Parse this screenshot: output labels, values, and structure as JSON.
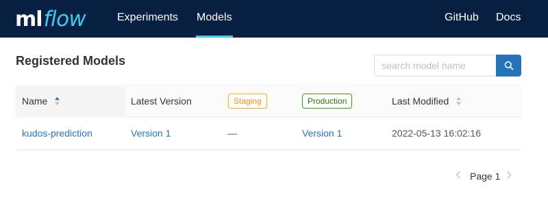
{
  "nav": {
    "logo_ml": "ml",
    "logo_flow": "flow",
    "experiments": "Experiments",
    "models": "Models",
    "github": "GitHub",
    "docs": "Docs",
    "active_tab": "Models"
  },
  "page": {
    "title": "Registered Models"
  },
  "search": {
    "placeholder": "search model name",
    "value": ""
  },
  "table": {
    "columns": {
      "name": "Name",
      "latest_version": "Latest Version",
      "staging": "Staging",
      "production": "Production",
      "last_modified": "Last Modified"
    },
    "rows": [
      {
        "name": "kudos-prediction",
        "latest_version": "Version 1",
        "staging": "—",
        "production": "Version 1",
        "last_modified": "2022-05-13 16:02:16"
      }
    ]
  },
  "pagination": {
    "label": "Page 1"
  },
  "colors": {
    "navbar": "#082041",
    "accent": "#43c9ed",
    "link": "#2374bb",
    "staging": "#fa8c16",
    "production": "#237804"
  },
  "icons": {
    "search": "search-icon",
    "sort": "sort-icon",
    "prev": "chevron-left-icon",
    "next": "chevron-right-icon"
  }
}
